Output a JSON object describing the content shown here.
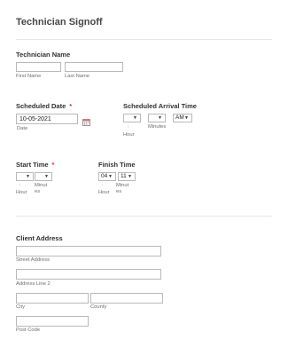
{
  "form_title": "Technician Signoff",
  "technician_name": {
    "label": "Technician Name",
    "first_sub": "First Name",
    "last_sub": "Last Name",
    "first_value": "",
    "last_value": ""
  },
  "scheduled_date": {
    "label": "Scheduled Date",
    "required_mark": "*",
    "value": "10-05-2021",
    "sub": "Date",
    "calendar_icon": "calendar-icon"
  },
  "scheduled_arrival": {
    "label": "Scheduled Arrival Time",
    "hour_value": "",
    "minute_value": "",
    "ampm_value": "AM",
    "colon": ":",
    "hour_sub": "Hour",
    "minute_sub": "Minutes"
  },
  "start_time": {
    "label": "Start Time",
    "required_mark": "*",
    "hour_value": "",
    "minute_value": "",
    "colon": ":",
    "hour_sub": "Hour",
    "minute_sub": "Minut es"
  },
  "finish_time": {
    "label": "Finish Time",
    "hour_value": "04",
    "minute_value": "11",
    "colon": ":",
    "hour_sub": "Hour",
    "minute_sub": "Minut es"
  },
  "client_address": {
    "label": "Client Address",
    "street_sub": "Street Address",
    "line2_sub": "Address Line 2",
    "city_sub": "City",
    "county_sub": "County",
    "postcode_sub": "Post Code"
  },
  "dropdown_caret": "▼"
}
